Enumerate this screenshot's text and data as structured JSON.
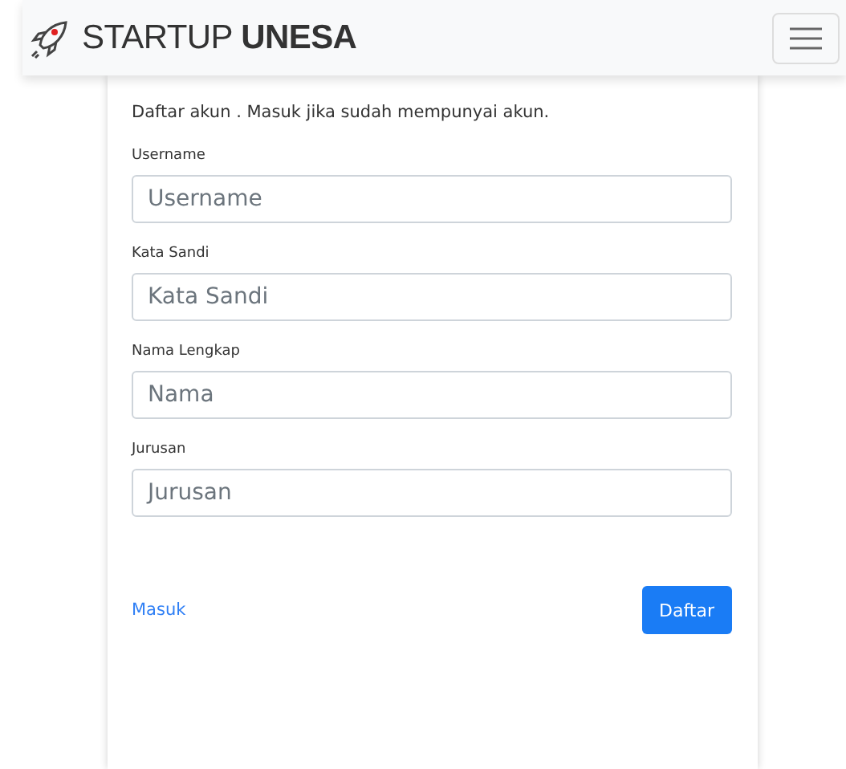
{
  "navbar": {
    "brand": "STARTUP **UNESA**"
  },
  "card": {
    "intro": "Daftar akun . Masuk jika sudah mempunyai akun.",
    "fields": [
      {
        "label": "Username",
        "placeholder": "Username"
      },
      {
        "label": "Kata Sandi",
        "placeholder": "Kata Sandi"
      },
      {
        "label": "Nama Lengkap",
        "placeholder": "Nama"
      },
      {
        "label": "Jurusan",
        "placeholder": "Jurusan"
      }
    ],
    "link": "Masuk",
    "submit": "Daftar"
  }
}
